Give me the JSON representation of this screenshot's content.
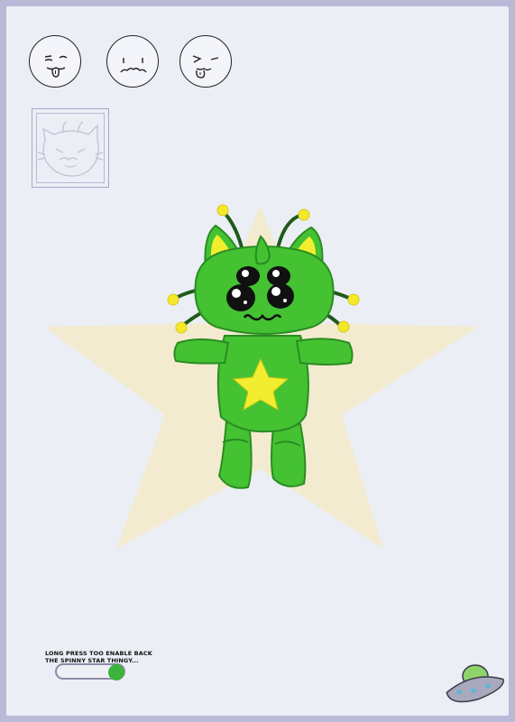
{
  "colors": {
    "background": "#eceef5",
    "border": "#b9b9d8",
    "star": "#f3ebcf",
    "creature_body": "#44c232",
    "creature_dark": "#2a8c22",
    "creature_yellow": "#f0ee2e",
    "toggle_knob": "#3cb43c"
  },
  "expressions": [
    {
      "icon": "tongue-out-face-icon"
    },
    {
      "icon": "pouting-face-icon"
    },
    {
      "icon": "winking-face-icon"
    }
  ],
  "portrait": {
    "icon": "cat-portrait-icon"
  },
  "creature": {
    "icon": "green-alien-cat-plush"
  },
  "toggle": {
    "hint": "LONG PRESS TOO ENABLE BACK THE SPINNY STAR THINGY...",
    "state": "on"
  },
  "ufo": {
    "icon": "ufo-icon"
  }
}
